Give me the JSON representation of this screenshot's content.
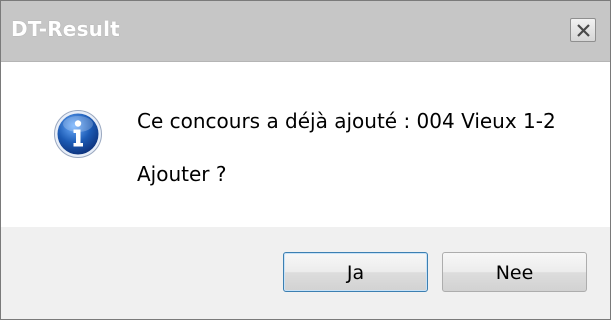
{
  "window": {
    "title": "DT-Result"
  },
  "message": {
    "line1": "Ce concours a déjà ajouté : 004  Vieux 1-2",
    "line2": "Ajouter ?",
    "icon": "info-icon"
  },
  "buttons": {
    "yes_label": "Ja",
    "no_label": "Nee"
  },
  "colors": {
    "titlebar": "#c6c6c6",
    "content_bg": "#ffffff",
    "footer_bg": "#f0f0f0",
    "icon_blue": "#1c5bb5"
  }
}
